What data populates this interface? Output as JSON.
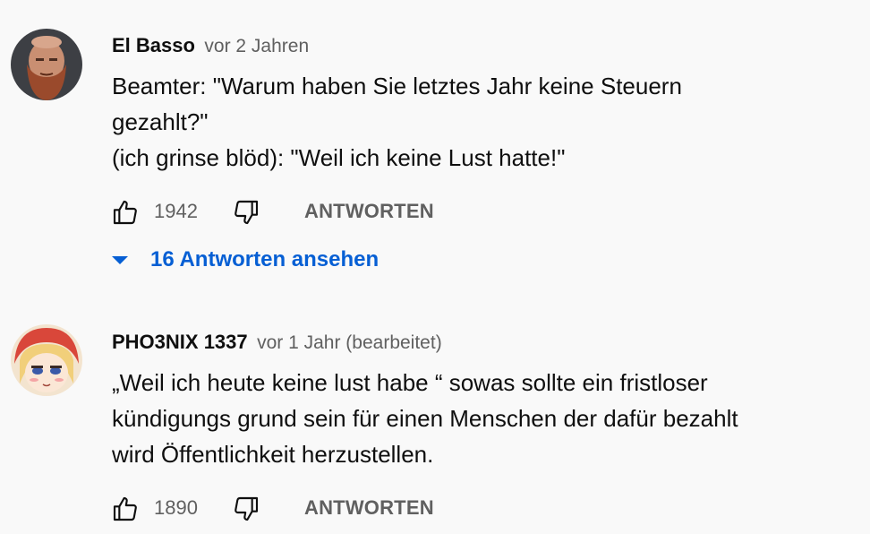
{
  "comments": [
    {
      "author": "El Basso",
      "time": "vor 2 Jahren",
      "text_lines": [
        "Beamter: \"Warum haben Sie letztes Jahr keine Steuern",
        "gezahlt?\"",
        "(ich grinse blöd): \"Weil ich keine Lust hatte!\""
      ],
      "likes": "1942",
      "reply_label": "ANTWORTEN",
      "replies_label": "16 Antworten ansehen"
    },
    {
      "author": "PHO3NIX 1337",
      "time": "vor 1 Jahr (bearbeitet)",
      "text_lines": [
        "„Weil ich heute keine lust habe “ sowas sollte ein fristloser",
        "kündigungs grund sein für einen Menschen der dafür bezahlt",
        "wird Öffentlichkeit herzustellen."
      ],
      "likes": "1890",
      "reply_label": "ANTWORTEN"
    }
  ],
  "icons": {
    "like": "thumb-up-icon",
    "dislike": "thumb-down-icon",
    "expand": "caret-down-icon"
  },
  "colors": {
    "background": "#f9f9f9",
    "link": "#065fd4",
    "secondary_text": "#606060"
  }
}
